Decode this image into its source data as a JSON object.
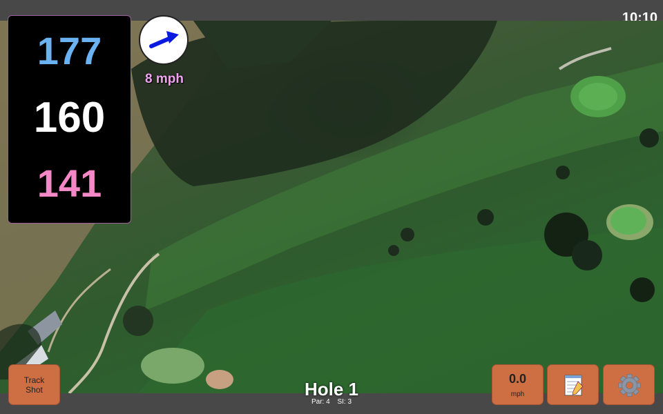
{
  "status": {
    "time": "10:10"
  },
  "distances": {
    "back": "177",
    "center": "160",
    "front": "141"
  },
  "wind": {
    "speed": "8 mph",
    "icon": "wind-arrow-icon",
    "arrow_color": "#0a1ae0"
  },
  "buttons": {
    "track_shot_line1": "Track",
    "track_shot_line2": "Shot",
    "speed_value": "0.0",
    "speed_unit": "mph",
    "notes_icon": "notepad-icon",
    "settings_icon": "gear-icon"
  },
  "hole": {
    "title": "Hole 1",
    "par": "Par: 4",
    "si": "SI: 3"
  },
  "colors": {
    "button": "#cd6e43",
    "back_distance": "#6ab2f2",
    "front_distance": "#f487c6",
    "wind_text": "#f0a3f0"
  }
}
